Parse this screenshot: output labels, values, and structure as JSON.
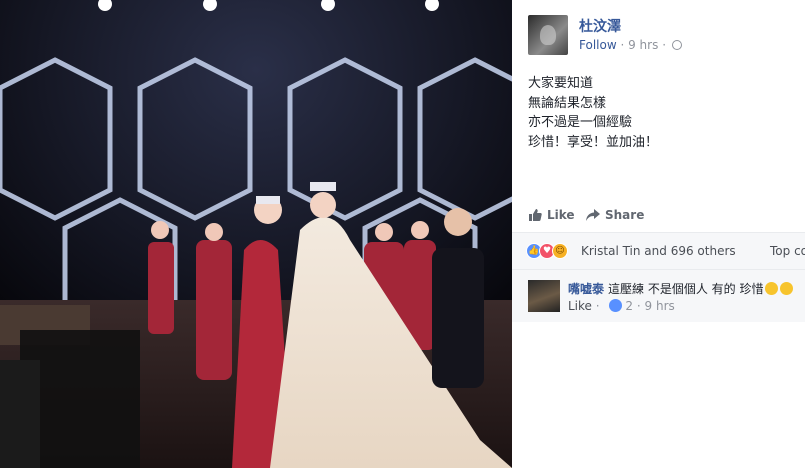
{
  "post": {
    "author": "杜汶澤",
    "follow_label": "Follow",
    "timestamp": "9 hrs",
    "lines": [
      "大家要知道",
      "無論結果怎樣",
      "亦不過是一個經驗",
      "珍惜！享受！並加油！"
    ]
  },
  "actions": {
    "like_label": "Like",
    "share_label": "Share"
  },
  "reactions": {
    "summary": "Kristal Tin and 696 others",
    "top_comments": "Top co"
  },
  "comment": {
    "author": "嘴嘘泰",
    "text": "這壓練 不是個個人 有的 珍惜",
    "like_label": "Like",
    "like_count": "2",
    "timestamp": "9 hrs"
  },
  "icons": {
    "privacy": "globe-icon",
    "like": "thumbs-up-icon",
    "share": "share-arrow-icon",
    "reactions": [
      "like-reaction-icon",
      "love-reaction-icon",
      "haha-reaction-icon"
    ],
    "comment_emoji": "smile-emoji-icon"
  },
  "colors": {
    "link": "#365899",
    "meta": "#90949c",
    "panel_bg": "#ffffff",
    "comment_bg": "#f6f7f9"
  }
}
